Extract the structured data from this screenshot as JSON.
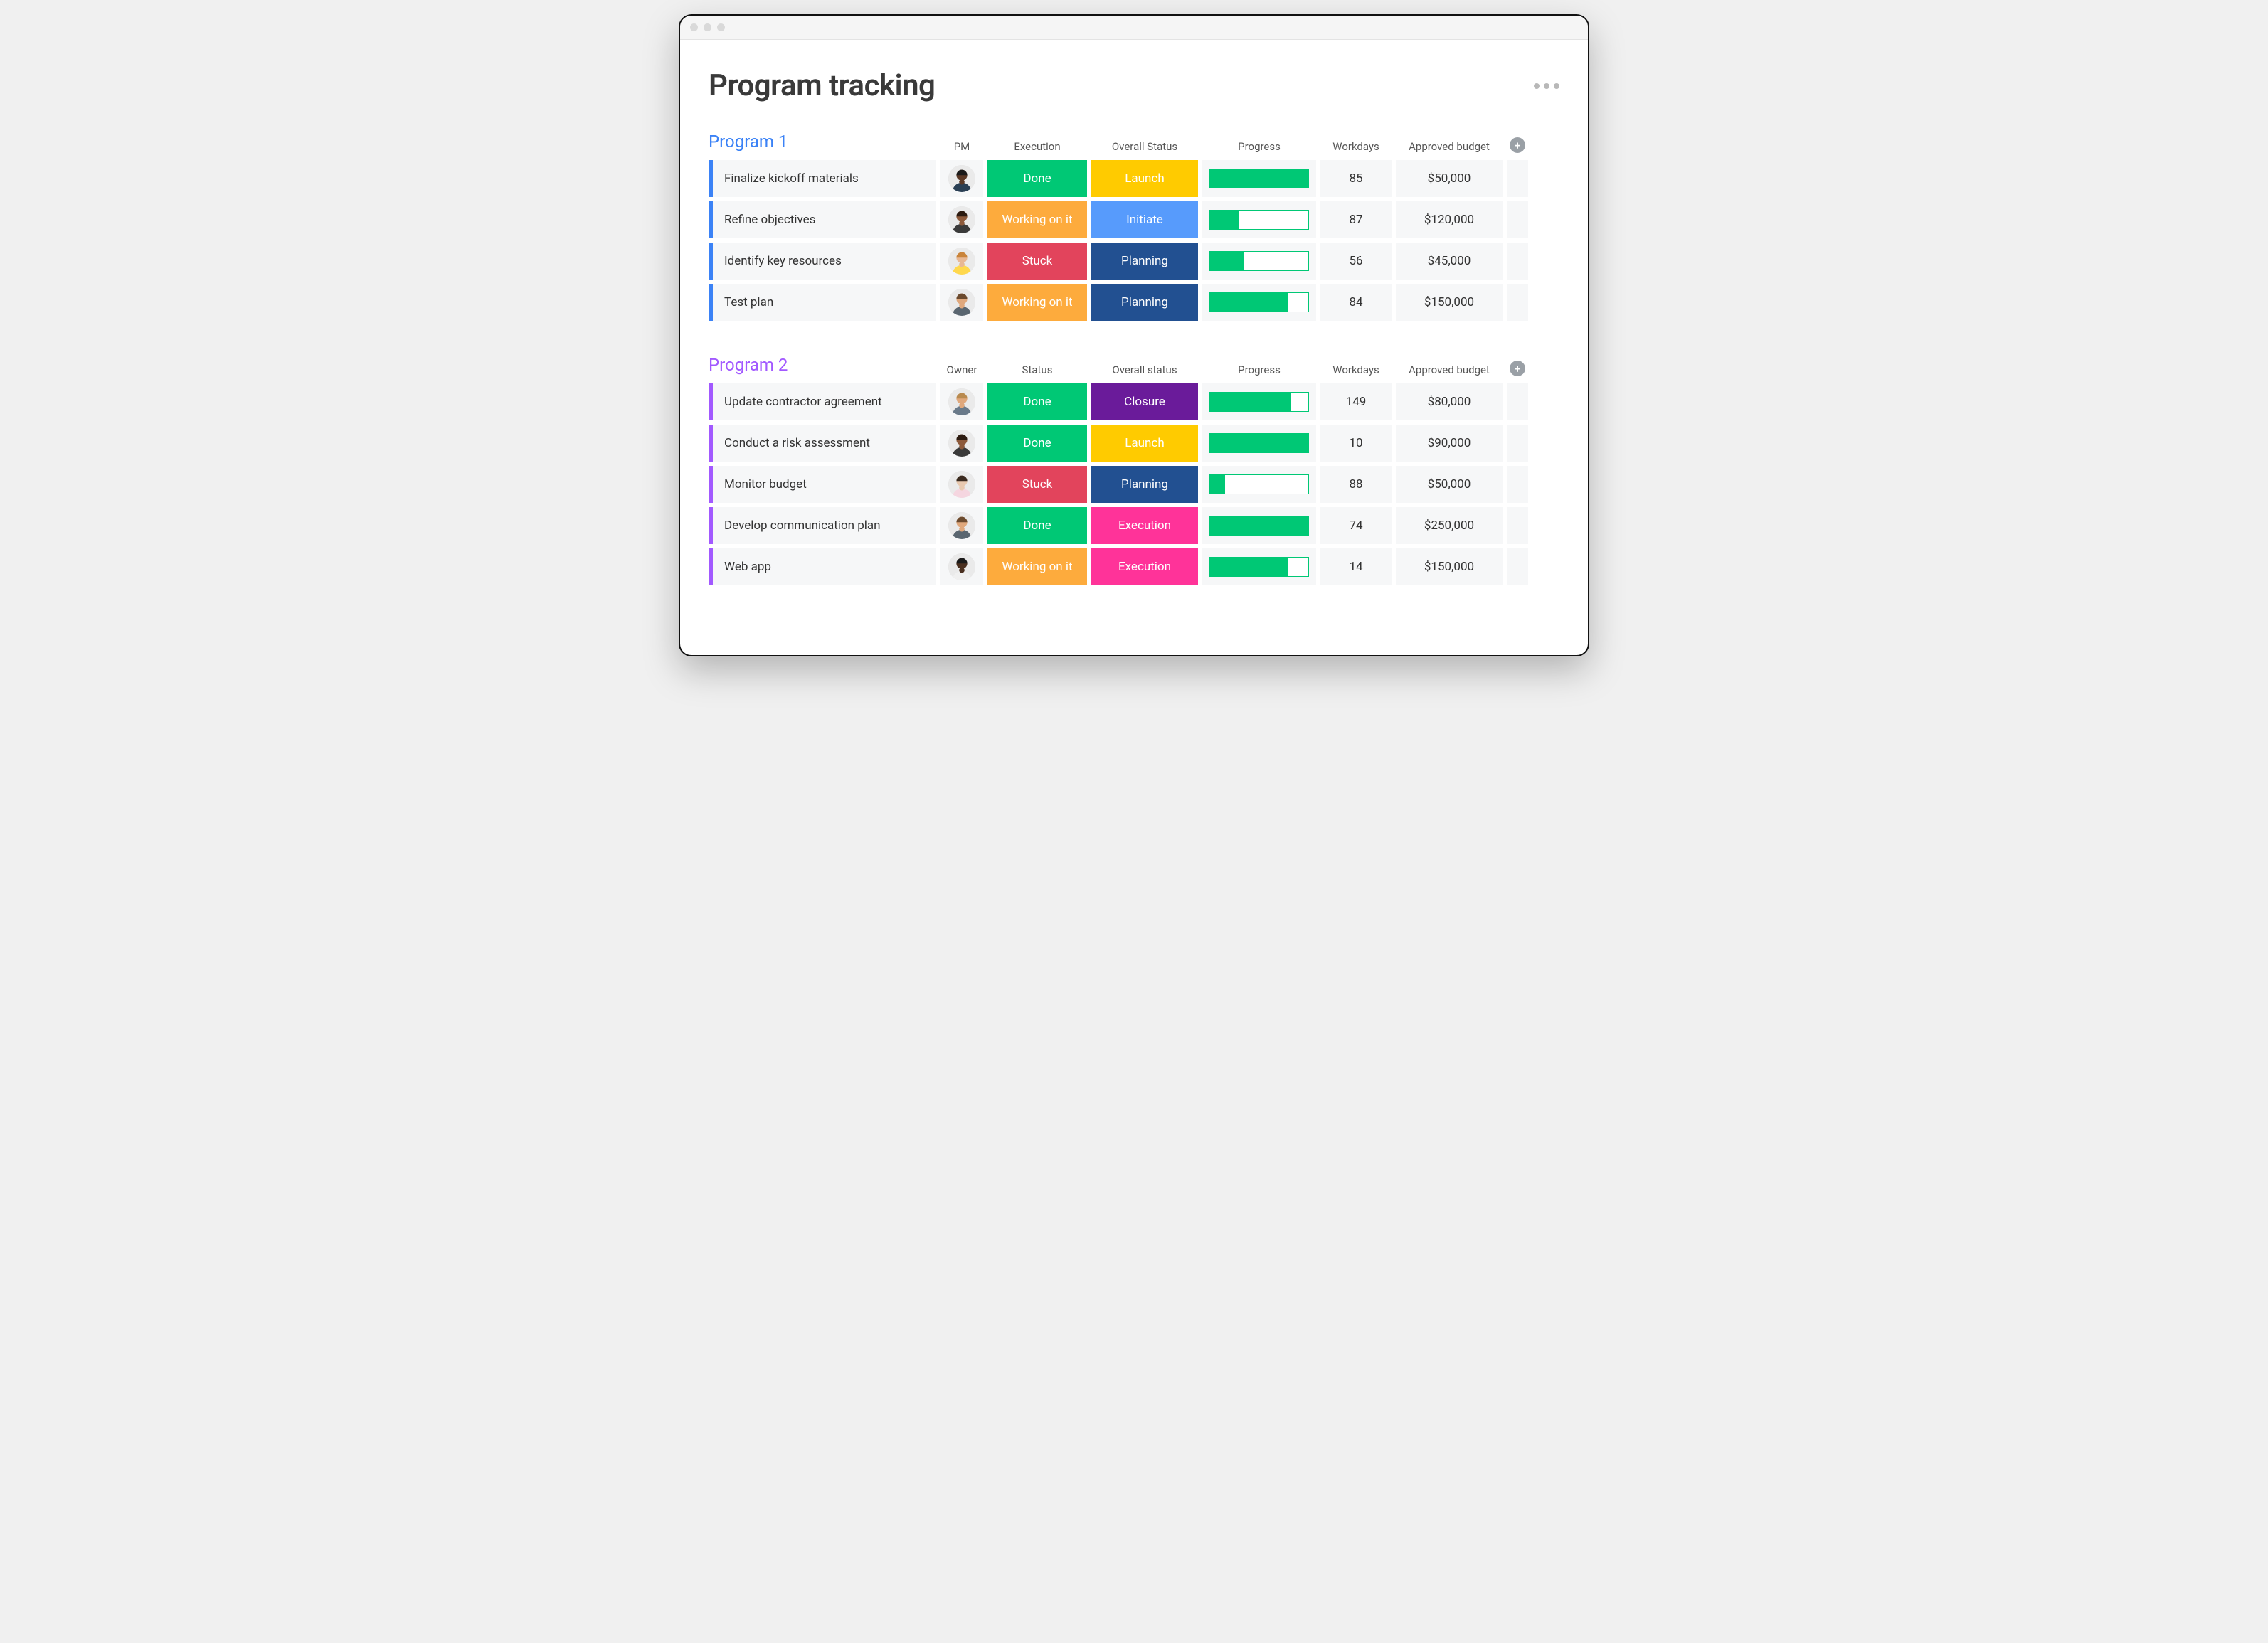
{
  "page": {
    "title": "Program tracking"
  },
  "colors": {
    "done": "#00c875",
    "working": "#fdab3d",
    "stuck": "#e2445c",
    "launch": "#ffcb00",
    "initiate": "#579bfc",
    "planning": "#225091",
    "closure": "#6a1b9a",
    "execution": "#ff3399",
    "group1": "#3b82f6",
    "group2": "#a259ff"
  },
  "groups": [
    {
      "title": "Program 1",
      "color": "group1",
      "columns": [
        "PM",
        "Execution",
        "Overall Status",
        "Progress",
        "Workdays",
        "Approved budget"
      ],
      "rows": [
        {
          "task": "Finalize kickoff materials",
          "avatar": {
            "skin": "#5a3825",
            "hair": "#1a1a1a",
            "shirt": "#2a3f54"
          },
          "execution": {
            "label": "Done",
            "color": "done"
          },
          "status": {
            "label": "Launch",
            "color": "launch"
          },
          "progress": 100,
          "workdays": "85",
          "budget": "$50,000"
        },
        {
          "task": "Refine objectives",
          "avatar": {
            "skin": "#8d5a3b",
            "hair": "#2b1a10",
            "shirt": "#3a3a3a"
          },
          "execution": {
            "label": "Working on it",
            "color": "working"
          },
          "status": {
            "label": "Initiate",
            "color": "initiate"
          },
          "progress": 30,
          "workdays": "87",
          "budget": "$120,000"
        },
        {
          "task": "Identify key resources",
          "avatar": {
            "skin": "#e8b894",
            "hair": "#c9843b",
            "shirt": "#ffd84d"
          },
          "execution": {
            "label": "Stuck",
            "color": "stuck"
          },
          "status": {
            "label": "Planning",
            "color": "planning"
          },
          "progress": 35,
          "workdays": "56",
          "budget": "$45,000"
        },
        {
          "task": "Test plan",
          "avatar": {
            "skin": "#e0a87c",
            "hair": "#6b4a2e",
            "shirt": "#5a6670"
          },
          "execution": {
            "label": "Working on it",
            "color": "working"
          },
          "status": {
            "label": "Planning",
            "color": "planning"
          },
          "progress": 80,
          "workdays": "84",
          "budget": "$150,000"
        }
      ]
    },
    {
      "title": "Program 2",
      "color": "group2",
      "columns": [
        "Owner",
        "Status",
        "Overall status",
        "Progress",
        "Workdays",
        "Approved budget"
      ],
      "rows": [
        {
          "task": "Update contractor agreement",
          "avatar": {
            "skin": "#e0a87c",
            "hair": "#b88a4f",
            "shirt": "#6a7a8a"
          },
          "execution": {
            "label": "Done",
            "color": "done"
          },
          "status": {
            "label": "Closure",
            "color": "closure"
          },
          "progress": 82,
          "workdays": "149",
          "budget": "$80,000"
        },
        {
          "task": "Conduct a risk assessment",
          "avatar": {
            "skin": "#8d5a3b",
            "hair": "#2b1a10",
            "shirt": "#3a3a3a"
          },
          "execution": {
            "label": "Done",
            "color": "done"
          },
          "status": {
            "label": "Launch",
            "color": "launch"
          },
          "progress": 100,
          "workdays": "10",
          "budget": "$90,000"
        },
        {
          "task": "Monitor budget",
          "avatar": {
            "skin": "#e8c9b0",
            "hair": "#3a2a1f",
            "shirt": "#f5d6e0"
          },
          "execution": {
            "label": "Stuck",
            "color": "stuck"
          },
          "status": {
            "label": "Planning",
            "color": "planning"
          },
          "progress": 15,
          "workdays": "88",
          "budget": "$50,000"
        },
        {
          "task": "Develop communication plan",
          "avatar": {
            "skin": "#e0a87c",
            "hair": "#6b4a2e",
            "shirt": "#5a6670"
          },
          "execution": {
            "label": "Done",
            "color": "done"
          },
          "status": {
            "label": "Execution",
            "color": "execution"
          },
          "progress": 100,
          "workdays": "74",
          "budget": "$250,000"
        },
        {
          "task": "Web app",
          "avatar": {
            "skin": "#4a2f1f",
            "hair": "#1a1a1a",
            "shirt": "#f0f0f0"
          },
          "execution": {
            "label": "Working on it",
            "color": "working"
          },
          "status": {
            "label": "Execution",
            "color": "execution"
          },
          "progress": 80,
          "workdays": "14",
          "budget": "$150,000"
        }
      ]
    }
  ]
}
